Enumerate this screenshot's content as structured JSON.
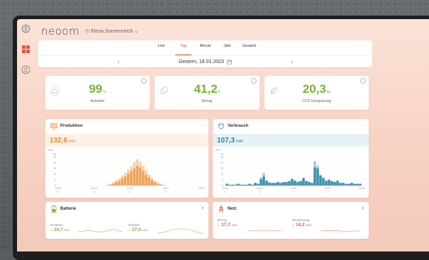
{
  "app": {
    "logo": "neoom",
    "user": "Elena Sonnenreich",
    "user_chevron": "⌄"
  },
  "sidebar": {
    "items": [
      {
        "icon": "globe-icon"
      },
      {
        "icon": "dashboard-icon"
      },
      {
        "icon": "user-icon"
      }
    ]
  },
  "tabs": [
    {
      "label": "Live"
    },
    {
      "label": "Tag",
      "active": true
    },
    {
      "label": "Monat"
    },
    {
      "label": "Jahr"
    },
    {
      "label": "Gesamt"
    }
  ],
  "date": {
    "label": "Gestern, 18.01.2023",
    "prev": "‹",
    "next": "›",
    "icon": "calendar-icon"
  },
  "kpis": [
    {
      "value": "99",
      "unit": "%",
      "label": "Autarkie",
      "icon": "house-icon",
      "info": "i"
    },
    {
      "value": "41,2",
      "unit": "€",
      "label": "Ertrag",
      "icon": "coins-icon",
      "info": "i"
    },
    {
      "value": "20,3",
      "unit": "kg",
      "label": "CO2 Einsparung",
      "icon": "leaf-icon",
      "info": "i"
    }
  ],
  "produktion": {
    "title": "Produktion",
    "menu": "···",
    "value": "132,6",
    "unit": "kWh",
    "color": "#f0a35a",
    "band": "#fdf0e4",
    "chart_data": {
      "type": "bar",
      "ylabel": "kWh",
      "ylim": [
        0,
        30
      ],
      "yticks": [
        "30",
        "25",
        "20",
        "15",
        "10",
        "5",
        "0"
      ],
      "xticks": [
        "00:00",
        "06:00",
        "12:00",
        "18:00",
        "24:00"
      ],
      "series": [
        {
          "values": [
            0,
            0,
            0,
            0,
            0,
            0,
            0,
            0,
            0,
            0,
            0,
            0,
            0,
            0,
            0,
            0,
            1,
            2,
            4,
            6,
            8,
            11,
            14,
            18,
            21,
            26,
            29,
            26,
            22,
            17,
            12,
            8,
            5,
            3,
            2,
            1,
            0,
            0,
            0,
            0,
            0,
            0,
            0,
            0,
            0,
            0,
            0,
            0
          ]
        },
        {
          "values": [
            0,
            0,
            0,
            0,
            0,
            0,
            0,
            0,
            0,
            0,
            0,
            0,
            0,
            0,
            0,
            0,
            0,
            1,
            2,
            4,
            5,
            8,
            10,
            13,
            16,
            19,
            22,
            20,
            16,
            12,
            9,
            6,
            4,
            2,
            1,
            0,
            0,
            0,
            0,
            0,
            0,
            0,
            0,
            0,
            0,
            0,
            0,
            0
          ]
        }
      ]
    }
  },
  "verbrauch": {
    "title": "Verbrauch",
    "menu": "···",
    "value": "107,3",
    "unit": "kWh",
    "color": "#3a8fb0",
    "band": "#e6f2f6",
    "chart_data": {
      "type": "bar",
      "ylabel": "kWh",
      "ylim": [
        0,
        30
      ],
      "yticks": [
        "30",
        "25",
        "20",
        "15",
        "10",
        "5",
        "0"
      ],
      "xticks": [
        "00:00",
        "06:00",
        "12:00",
        "18:00",
        "24:00"
      ],
      "series": [
        {
          "values": [
            2,
            1,
            1,
            1,
            2,
            1,
            1,
            1,
            2,
            1,
            3,
            2,
            9,
            14,
            6,
            4,
            3,
            3,
            4,
            3,
            4,
            4,
            5,
            8,
            6,
            4,
            5,
            9,
            5,
            4,
            3,
            27,
            22,
            12,
            9,
            6,
            7,
            5,
            4,
            6,
            3,
            3,
            2,
            2,
            3,
            2,
            2,
            2
          ]
        },
        {
          "values": [
            2,
            1,
            1,
            1,
            2,
            1,
            1,
            1,
            2,
            1,
            3,
            2,
            7,
            10,
            5,
            3,
            3,
            3,
            4,
            3,
            4,
            4,
            5,
            7,
            5,
            4,
            5,
            8,
            5,
            4,
            3,
            20,
            19,
            11,
            8,
            5,
            6,
            5,
            4,
            5,
            3,
            3,
            2,
            2,
            3,
            2,
            2,
            2
          ]
        }
      ]
    }
  },
  "batterie": {
    "title": "Batterie",
    "plus": "+",
    "entladen_label": "Entladen",
    "entladen_arrow": "↑",
    "entladen_value": "20,7",
    "entladen_unit": "kWh",
    "beladen_label": "Beladen",
    "beladen_arrow": "↓",
    "beladen_value": "27,9",
    "beladen_unit": "kWh",
    "color": "#7ab23a"
  },
  "netz": {
    "title": "Netz",
    "plus": "+",
    "bezug_label": "Bezug",
    "bezug_arrow": "↑",
    "bezug_value": "17,7",
    "bezug_unit": "kWh",
    "einspeisung_label": "Einspeisung",
    "einspeisung_arrow": "↓",
    "einspeisung_value": "14,2",
    "einspeisung_unit": "kWh",
    "color": "#e0533e"
  }
}
